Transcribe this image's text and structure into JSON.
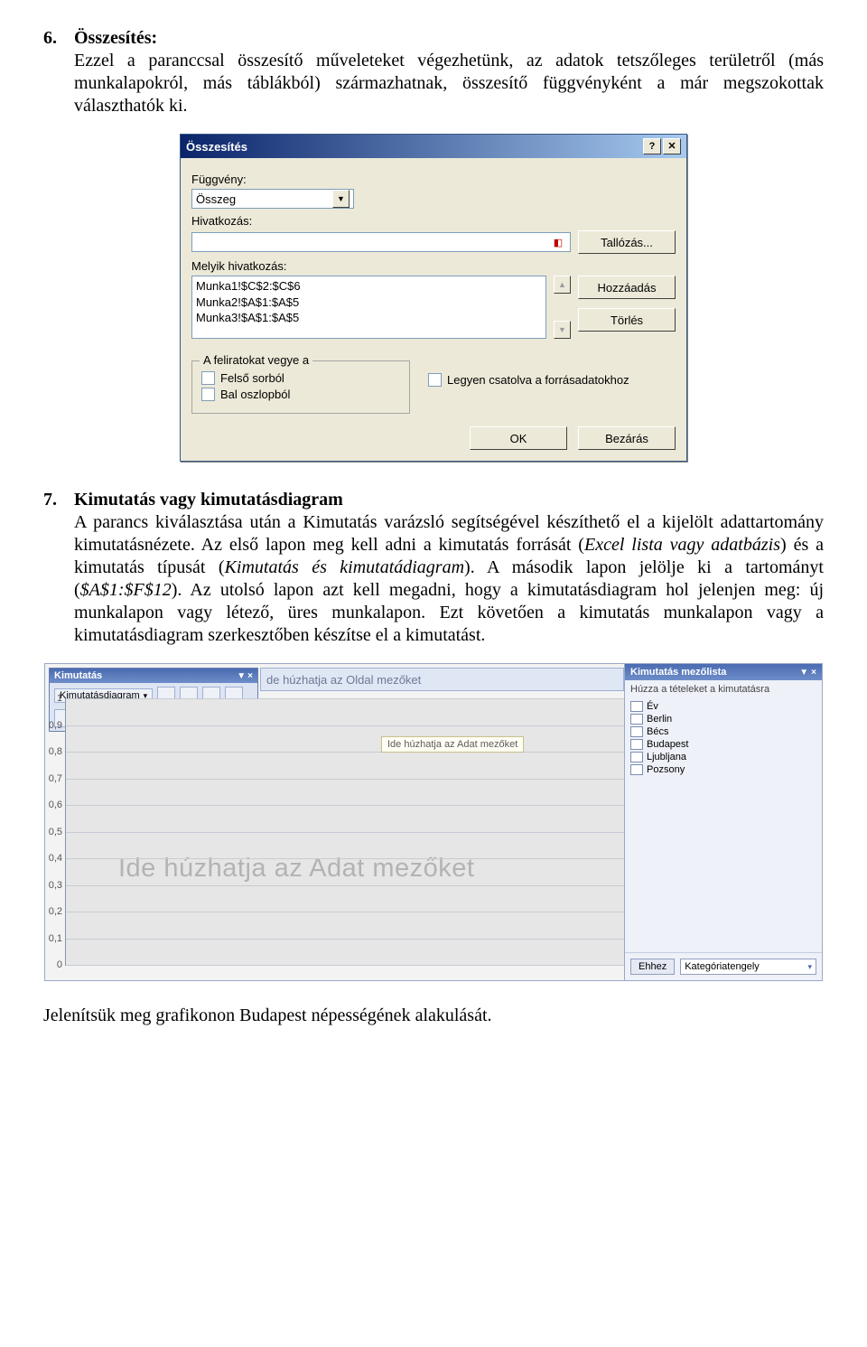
{
  "sections": {
    "s6": {
      "num": "6.",
      "title": "Összesítés:",
      "text": "Ezzel a paranccsal összesítő műveleteket végezhetünk, az adatok tetszőleges területről (más munkalapokról, más táblákból) származhatnak, összesítő függvényként a már megszokottak választhatók ki."
    },
    "s7": {
      "num": "7.",
      "title": "Kimutatás vagy kimutatásdiagram",
      "text": "A parancs kiválasztása után a Kimutatás varázsló segítségével készíthető el a kijelölt adattartomány kimutatásnézete. Az első lapon meg kell adni a kimutatás forrását (Excel lista vagy adatbázis) és a kimutatás típusát (Kimutatás és kimutatádiagram). A második lapon jelölje ki a tartományt ($A$1:$F$12). Az utolsó lapon azt kell megadni, hogy a kimutatásdiagram hol jelenjen meg: új munkalapon vagy létező, üres munkalapon. Ezt követően a kimutatás munkalapon vagy a kimutatásdiagram szerkesztőben készítse el a kimutatást.",
      "italic_ranges": [
        "Excel lista vagy adatbázis",
        "Kimutatás és kimutatádiagram",
        "$A$1:$F$12"
      ]
    }
  },
  "dialog": {
    "title": "Összesítés",
    "labels": {
      "function": "Függvény:",
      "reference": "Hivatkozás:",
      "which_ref": "Melyik hivatkozás:",
      "labels_from": "A feliratokat vegye a",
      "chk_top": "Felső sorból",
      "chk_left": "Bal oszlopból",
      "chk_link": "Legyen csatolva a forrásadatokhoz"
    },
    "function_value": "Összeg",
    "buttons": {
      "browse": "Tallózás...",
      "add": "Hozzáadás",
      "delete": "Törlés",
      "ok": "OK",
      "close": "Bezárás"
    },
    "ref_list": [
      "Munka1!$C$2:$C$6",
      "Munka2!$A$1:$A$5",
      "Munka3!$A$1:$A$5"
    ]
  },
  "pivot": {
    "toolbar_title": "Kimutatás",
    "toolbar_drop": "Kimutatásdiagram",
    "drop_page": "de húzhatja az Oldal mezőket",
    "drop_adat_strip": "Ide húzhatja az Adat mezőket",
    "watermark": "Ide húzhatja az Adat mezőket",
    "y_ticks": [
      "1",
      "0,9",
      "0,8",
      "0,7",
      "0,6",
      "0,5",
      "0,4",
      "0,3",
      "0,2",
      "0,1",
      "0"
    ],
    "fieldlist": {
      "title": "Kimutatás mezőlista",
      "subtitle": "Húzza a tételeket a kimutatásra",
      "items": [
        "Év",
        "Berlin",
        "Bécs",
        "Budapest",
        "Ljubljana",
        "Pozsony"
      ],
      "add_btn": "Ehhez",
      "select_value": "Kategóriatengely"
    }
  },
  "footer_sentence": "Jelenítsük meg grafikonon Budapest népességének alakulását.",
  "chart_data": {
    "type": "bar",
    "categories": [],
    "values": [],
    "title": "",
    "xlabel": "",
    "ylabel": "",
    "ylim": [
      0,
      1
    ],
    "yticks": [
      0,
      0.1,
      0.2,
      0.3,
      0.4,
      0.5,
      0.6,
      0.7,
      0.8,
      0.9,
      1
    ]
  }
}
